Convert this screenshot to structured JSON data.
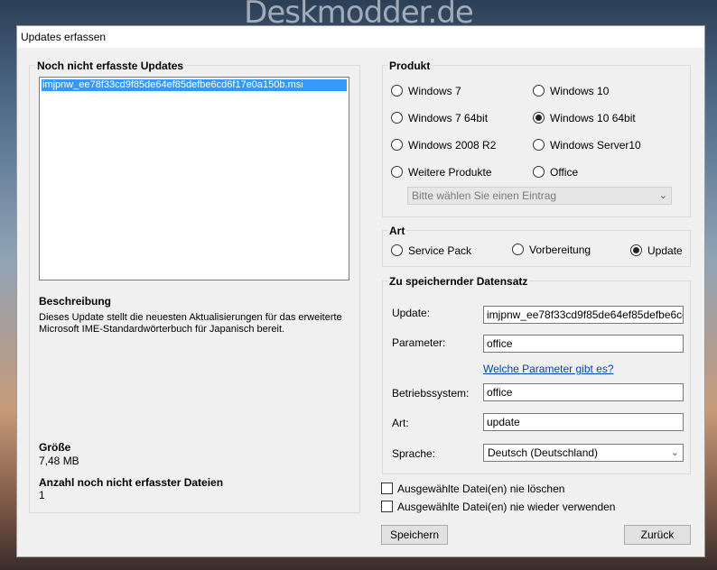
{
  "watermark": "Deskmodder.de",
  "window": {
    "title": "Updates erfassen"
  },
  "left": {
    "group_title": "Noch nicht erfasste Updates",
    "list_items": [
      "imjpnw_ee78f33cd9f85de64ef85defbe6cd6f17e0a150b.msi"
    ],
    "description_title": "Beschreibung",
    "description_text": "Dieses Update stellt die neuesten Aktualisierungen für das erweiterte Microsoft IME-Standardwörterbuch für Japanisch bereit.",
    "size_title": "Größe",
    "size_value": "7,48 MB",
    "count_title": "Anzahl noch nicht erfasster Dateien",
    "count_value": "1"
  },
  "produkt": {
    "title": "Produkt",
    "options": [
      {
        "label": "Windows 7",
        "selected": false
      },
      {
        "label": "Windows 10",
        "selected": false
      },
      {
        "label": "Windows 7 64bit",
        "selected": false
      },
      {
        "label": "Windows 10 64bit",
        "selected": true
      },
      {
        "label": "Windows 2008 R2",
        "selected": false
      },
      {
        "label": "Windows Server10",
        "selected": false
      },
      {
        "label": "Weitere Produkte",
        "selected": false
      },
      {
        "label": "Office",
        "selected": false
      }
    ],
    "dropdown_placeholder": "Bitte wählen Sie einen Eintrag"
  },
  "art": {
    "title": "Art",
    "options": [
      {
        "label": "Service Pack",
        "selected": false
      },
      {
        "label": "Vorbereitung",
        "selected": false
      },
      {
        "label": "Update",
        "selected": true
      }
    ]
  },
  "record": {
    "title": "Zu speichernder Datensatz",
    "update_label": "Update:",
    "update_value": "imjpnw_ee78f33cd9f85de64ef85defbe6cd6f1",
    "parameter_label": "Parameter:",
    "parameter_value": "office",
    "help_link": "Welche Parameter gibt es?",
    "os_label": "Betriebssystem:",
    "os_value": "office",
    "art_label": "Art:",
    "art_value": "update",
    "language_label": "Sprache:",
    "language_value": "Deutsch (Deutschland)"
  },
  "options": {
    "never_delete": "Ausgewählte Datei(en) nie löschen",
    "never_reuse": "Ausgewählte Datei(en) nie wieder verwenden"
  },
  "buttons": {
    "save": "Speichern",
    "back": "Zurück"
  }
}
